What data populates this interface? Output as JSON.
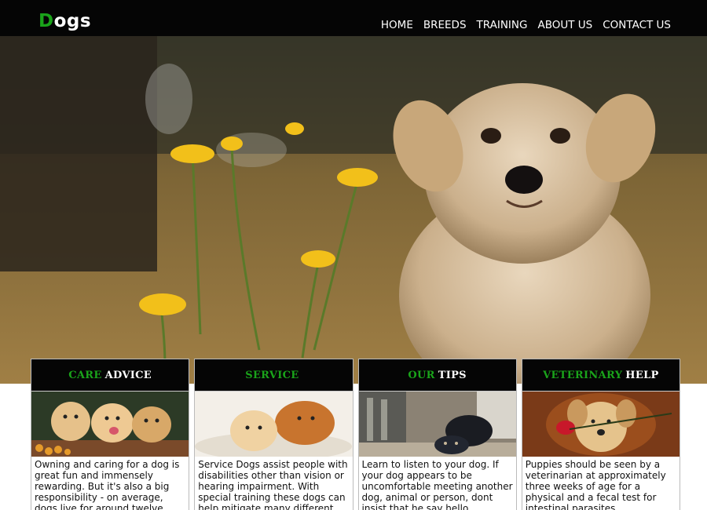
{
  "header": {
    "logo_first": "D",
    "logo_rest": "ogs",
    "nav": [
      "HOME",
      "BREEDS",
      "TRAINING",
      "ABOUT US",
      "CONTACT US"
    ]
  },
  "cards": [
    {
      "title_green": "CARE",
      "title_white": "ADVICE",
      "text": "Owning and caring for a dog is great fun and immensely rewarding. But it's also a big responsibility - on average, dogs live for around twelve years, but"
    },
    {
      "title_green": "SERVICE",
      "title_white": "",
      "text": "Service Dogs assist people with disabilities other than vision or hearing impairment. With special training these dogs can help mitigate many different types of"
    },
    {
      "title_green": "OUR",
      "title_white": "TIPS",
      "text": "Learn to listen to your dog. If your dog appears to be uncomfortable meeting another dog, animal or person, dont insist that he say hello."
    },
    {
      "title_green": "VETERINARY",
      "title_white": "HELP",
      "text": "Puppies should be seen by a veterinarian at approximately three weeks of age for a physical and a fecal test for intestinal parasites."
    }
  ],
  "colors": {
    "accent": "#1aa31a",
    "bar": "#050505"
  }
}
